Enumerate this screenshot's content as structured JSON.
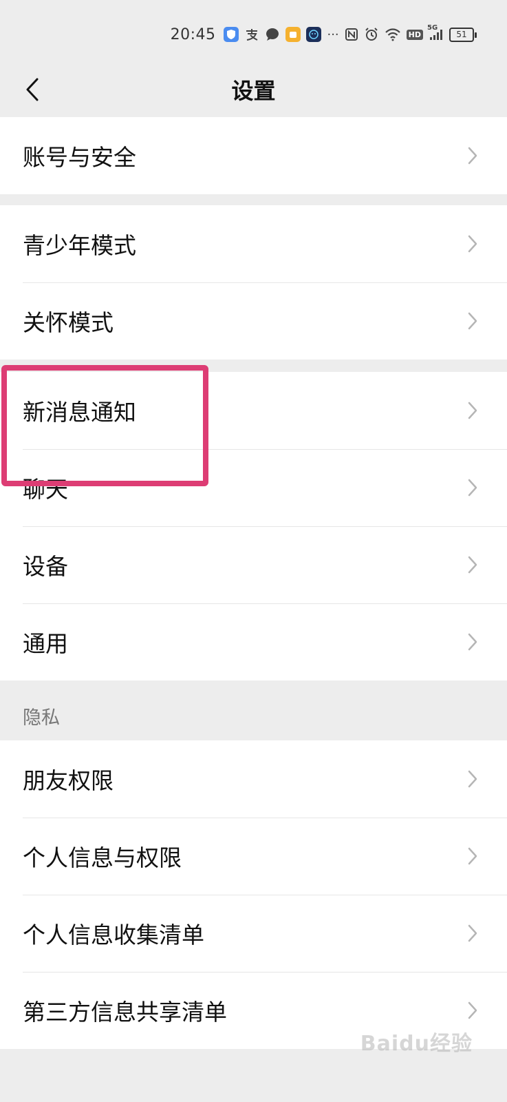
{
  "status_bar": {
    "time": "20:45",
    "icons": [
      "shield-app-icon",
      "alipay-icon",
      "chat-bubble-icon",
      "yellow-app-icon",
      "bot-app-icon",
      "more-dots-icon",
      "nfc-icon",
      "alarm-icon",
      "wifi-icon",
      "hd-icon",
      "signal-5g-icon"
    ],
    "more": "···",
    "hd_label": "HD",
    "network_label": "5G",
    "battery": "51"
  },
  "header": {
    "title": "设置",
    "back_icon": "chevron-left-icon"
  },
  "groups": {
    "account": [
      "账号与安全"
    ],
    "modes": [
      "青少年模式",
      "关怀模式"
    ],
    "general": [
      "新消息通知",
      "聊天",
      "设备",
      "通用"
    ],
    "privacy": [
      "朋友权限",
      "个人信息与权限",
      "个人信息收集清单",
      "第三方信息共享清单"
    ]
  },
  "section_privacy_title": "隐私",
  "highlight_color": "#dd3d74",
  "watermark": "Baidu经验"
}
